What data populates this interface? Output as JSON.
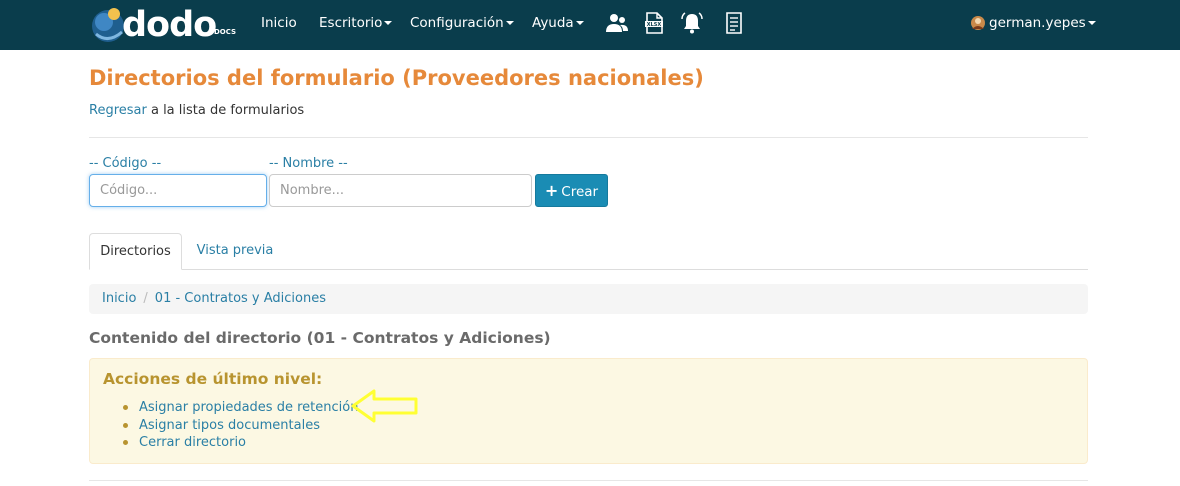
{
  "navbar": {
    "brand": "dodo",
    "brand_sub": "DOCS",
    "menu": [
      {
        "label": "Inicio"
      },
      {
        "label": "Escritorio"
      },
      {
        "label": "Configuración"
      },
      {
        "label": "Ayuda"
      }
    ],
    "icons": [
      "users-icon",
      "xlsx-file-icon",
      "bell-icon",
      "document-list-icon"
    ],
    "user": "german.yepes"
  },
  "header": {
    "title": "Directorios del formulario (Proveedores nacionales)",
    "back_link": "Regresar",
    "back_text": " a la lista de formularios"
  },
  "form": {
    "codigo_label": "-- Código --",
    "codigo_placeholder": "Código...",
    "nombre_label": "-- Nombre --",
    "nombre_placeholder": "Nombre...",
    "create_label": "Crear"
  },
  "tabs": [
    {
      "label": "Directorios",
      "active": true
    },
    {
      "label": "Vista previa",
      "active": false
    }
  ],
  "breadcrumb": [
    "Inicio",
    "01 - Contratos y Adiciones"
  ],
  "section_title": "Contenido del directorio (01 - Contratos y Adiciones)",
  "actions": {
    "title": "Acciones de último nivel:",
    "items": [
      "Asignar propiedades de retención",
      "Asignar tipos documentales",
      "Cerrar directorio"
    ]
  },
  "colors": {
    "navbar": "#0a3d4c",
    "title": "#e6893a",
    "link": "#2a7fa5",
    "primary_button": "#1a8cb4",
    "alert_bg": "#fcf8e3",
    "alert_title": "#b8942f",
    "annotation_arrow": "#ffff33"
  }
}
